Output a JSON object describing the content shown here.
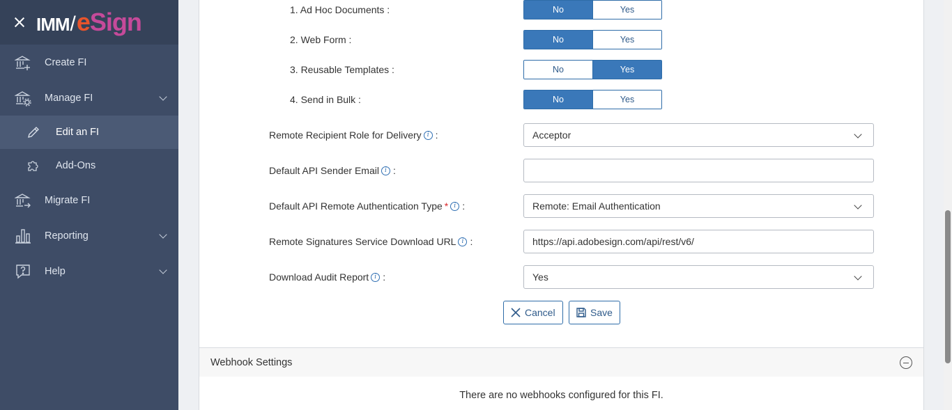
{
  "brand": {
    "imm": "IMM",
    "slash": "/",
    "esign_e": "e",
    "esign_rest": "Sign"
  },
  "sidebar": {
    "items": [
      {
        "label": "Create FI",
        "icon": "bank-plus-icon"
      },
      {
        "label": "Manage FI",
        "icon": "bank-gear-icon"
      },
      {
        "label": "Edit an FI",
        "icon": "pencil-icon"
      },
      {
        "label": "Add-Ons",
        "icon": "puzzle-icon"
      },
      {
        "label": "Migrate FI",
        "icon": "bank-arrow-icon"
      },
      {
        "label": "Reporting",
        "icon": "bar-chart-icon"
      },
      {
        "label": "Help",
        "icon": "question-bubble-icon"
      }
    ]
  },
  "features": [
    {
      "label": "1. Ad Hoc Documents :",
      "no": "No",
      "yes": "Yes",
      "selected": "No"
    },
    {
      "label": "2. Web Form :",
      "no": "No",
      "yes": "Yes",
      "selected": "No"
    },
    {
      "label": "3. Reusable Templates :",
      "no": "No",
      "yes": "Yes",
      "selected": "Yes"
    },
    {
      "label": "4. Send in Bulk :",
      "no": "No",
      "yes": "Yes",
      "selected": "No"
    }
  ],
  "fields": {
    "recipient_role": {
      "label": "Remote Recipient Role for Delivery",
      "colon": ":",
      "value": "Acceptor"
    },
    "sender_email": {
      "label": "Default API Sender Email",
      "colon": ":",
      "value": ""
    },
    "auth_type": {
      "label": "Default API Remote Authentication Type",
      "required": "*",
      "colon": ":",
      "value": "Remote: Email Authentication"
    },
    "download_url": {
      "label": "Remote Signatures Service Download URL",
      "colon": ":",
      "value": "https://api.adobesign.com/api/rest/v6/"
    },
    "audit_report": {
      "label": "Download Audit Report",
      "colon": ":",
      "value": "Yes"
    }
  },
  "info_glyph": "i",
  "buttons": {
    "cancel": "Cancel",
    "save": "Save"
  },
  "webhook": {
    "title": "Webhook Settings",
    "empty_message": "There are no webhooks configured for this FI."
  },
  "colors": {
    "sidebar": "#3e4c66",
    "accent": "#3a78b9",
    "brand_e": "#e8542b",
    "brand_sign": "#c54a9a"
  }
}
